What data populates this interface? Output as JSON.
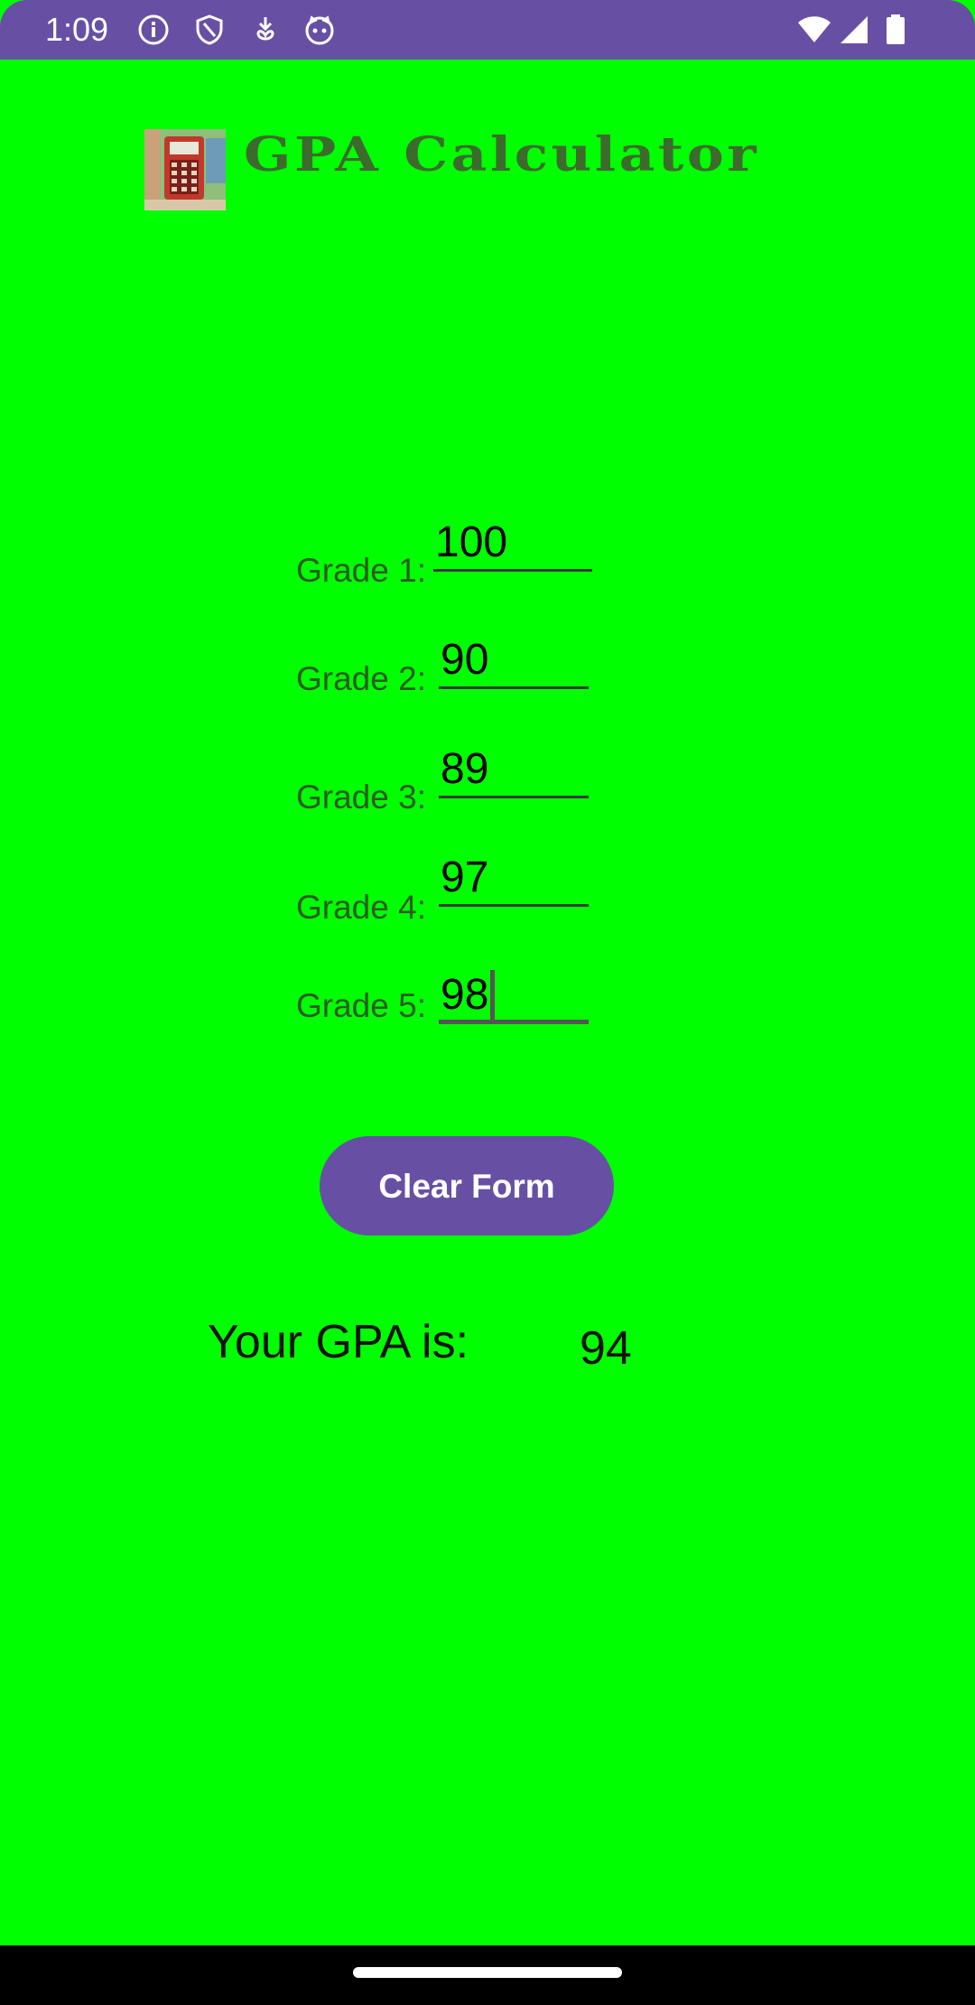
{
  "status_bar": {
    "time": "1:09",
    "left_icons": [
      "info-icon",
      "shield-icon",
      "download-icon",
      "cat-face-icon"
    ],
    "right_icons": [
      "wifi-icon",
      "signal-icon",
      "battery-icon"
    ],
    "color": "#6750a4"
  },
  "header": {
    "title": "GPA Calculator",
    "logo": "calculator-logo"
  },
  "grades": [
    {
      "label": "Grade 1:",
      "value": "100"
    },
    {
      "label": "Grade 2:",
      "value": "90"
    },
    {
      "label": "Grade 3:",
      "value": "89"
    },
    {
      "label": "Grade 4:",
      "value": "97"
    },
    {
      "label": "Grade 5:",
      "value": "98",
      "focused": true
    }
  ],
  "clear_button": {
    "label": "Clear Form"
  },
  "result": {
    "label": "Your GPA is:",
    "value": "94"
  },
  "colors": {
    "background": "#00ff00",
    "accent": "#6750a4",
    "title": "#3d6b2d"
  }
}
